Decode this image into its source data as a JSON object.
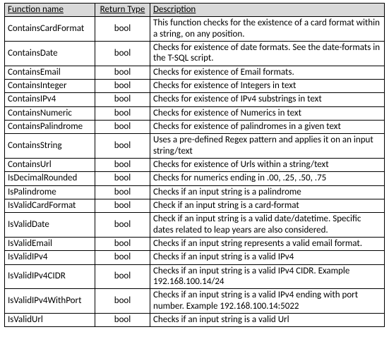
{
  "headers": {
    "name": "Function name",
    "type": "Return Type",
    "desc": "Description"
  },
  "rows": [
    {
      "name": "ContainsCardFormat",
      "type": "bool",
      "desc": "This function checks for the existence of a card format within a string, on any position."
    },
    {
      "name": "ContainsDate",
      "type": "bool",
      "desc": "Checks for existence of date formats. See the date-formats in the T-SQL script."
    },
    {
      "name": "ContainsEmail",
      "type": "bool",
      "desc": "Checks for existence of Email formats."
    },
    {
      "name": "ContainsInteger",
      "type": "bool",
      "desc": "Checks for existence of Integers in text"
    },
    {
      "name": "ContainsIPv4",
      "type": "bool",
      "desc": "Checks for existence of IPv4 substrings in text"
    },
    {
      "name": "ContainsNumeric",
      "type": "bool",
      "desc": "Checks for existence of Numerics in text"
    },
    {
      "name": "ContainsPalindrome",
      "type": "bool",
      "desc": "Checks for existence of palindromes in a given text"
    },
    {
      "name": "ContainsString",
      "type": "bool",
      "desc": "Uses a pre-defined Regex pattern and applies it on an input string/text"
    },
    {
      "name": "ContainsUrl",
      "type": "bool",
      "desc": "Checks for existence of Urls within a string/text"
    },
    {
      "name": "IsDecimalRounded",
      "type": "bool",
      "desc": "Checks for numerics ending in .00, .25, .50, .75"
    },
    {
      "name": "IsPalindrome",
      "type": "bool",
      "desc": "Checks if an input string is a palindrome"
    },
    {
      "name": "IsValidCardFormat",
      "type": "bool",
      "desc": "Check if an input string is a card-format"
    },
    {
      "name": "IsValidDate",
      "type": "bool",
      "desc": "Check if an input string is a valid date/datetime. Specific dates related to leap years are also considered."
    },
    {
      "name": "IsValidEmail",
      "type": "bool",
      "desc": "Checks if an input string represents a valid email format."
    },
    {
      "name": "IsValidIPv4",
      "type": "bool",
      "desc": "Checks if an input string is a valid IPv4"
    },
    {
      "name": "IsValidIPv4CIDR",
      "type": "bool",
      "desc": "Checks if an input string is a valid IPv4 CIDR. Example 192.168.100.14/24"
    },
    {
      "name": "IsValidIPv4WithPort",
      "type": "bool",
      "desc": "Checks if an input string is a valid IPv4 ending with port number. Example 192.168.100.14:5022"
    },
    {
      "name": "IsValidUrl",
      "type": "bool",
      "desc": "Checks if an input string is a valid Url"
    }
  ]
}
